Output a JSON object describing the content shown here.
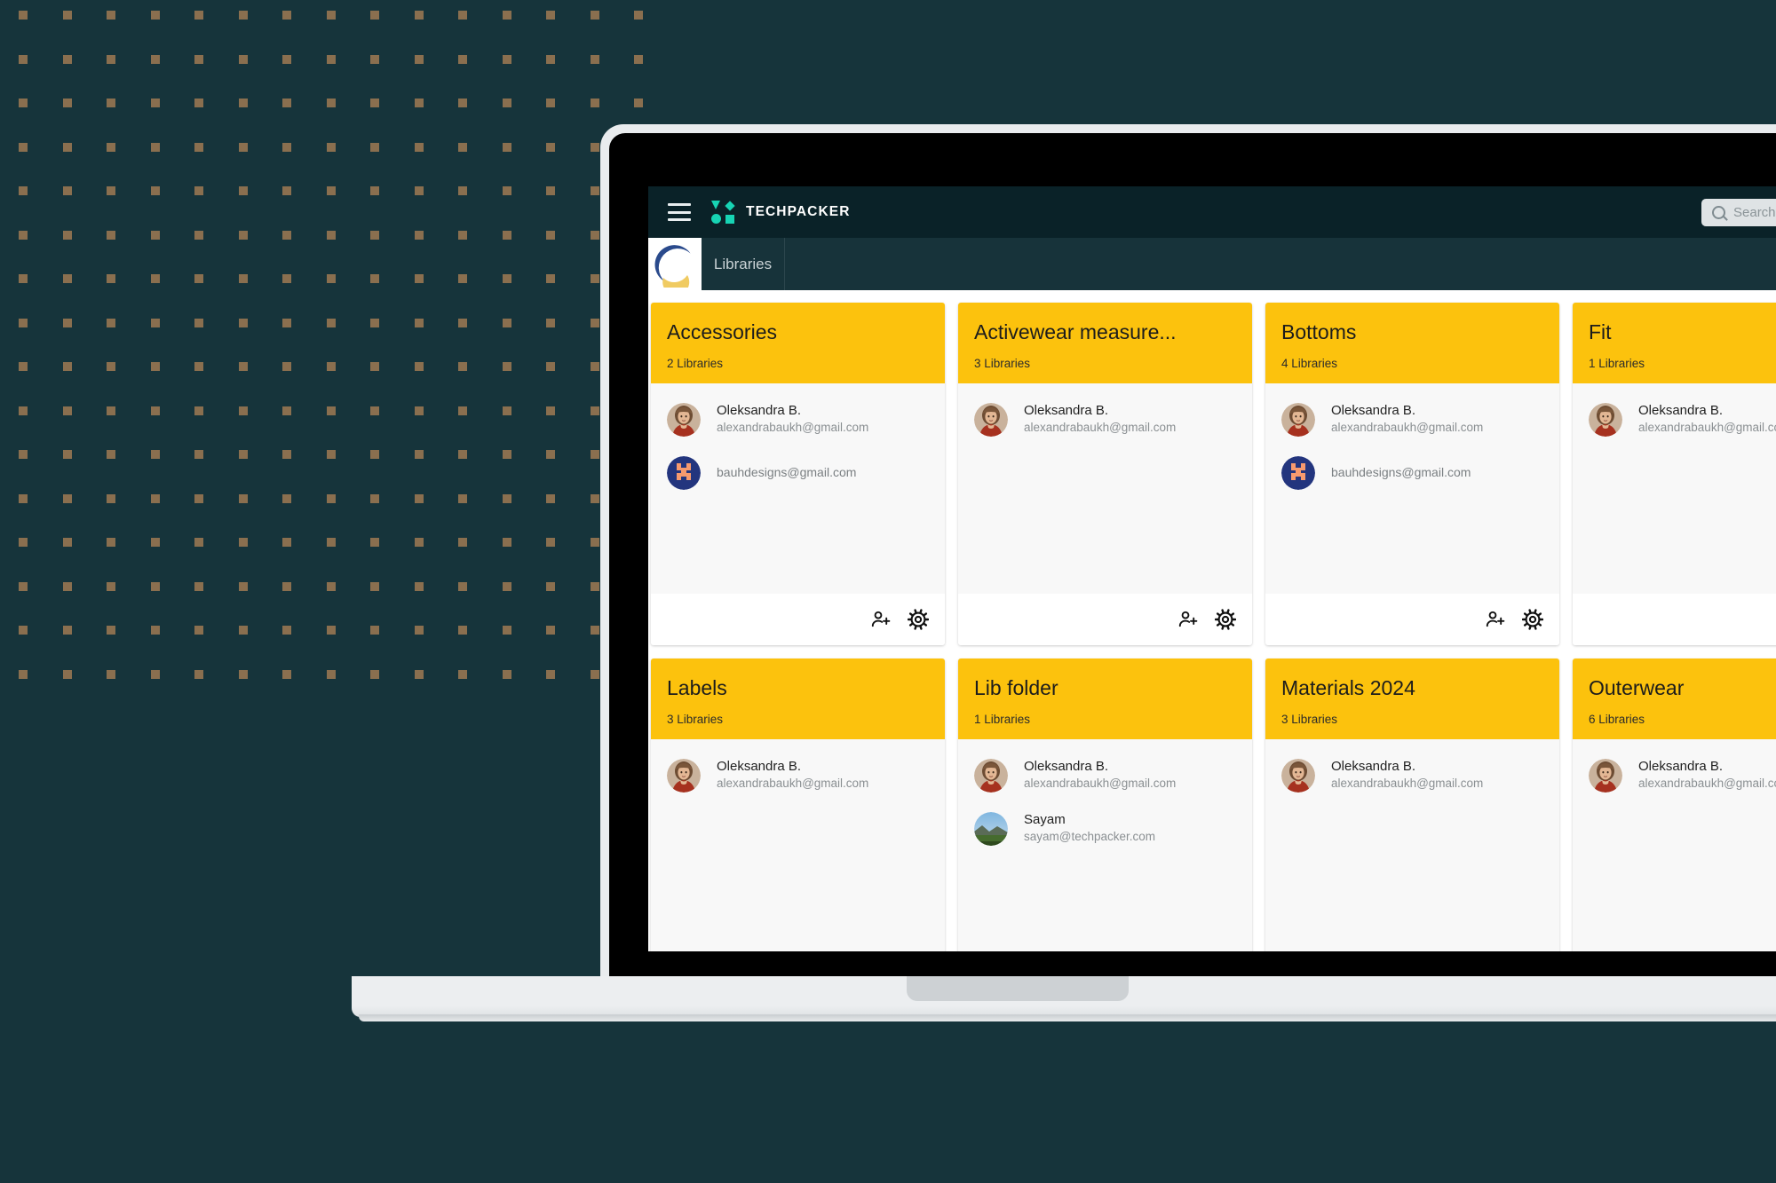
{
  "theme": {
    "backdrop": "#16343b",
    "dot_color": "#8a6f4f",
    "navbar_bg": "#0a2228",
    "tabbar_bg": "#17333a",
    "card_header_yellow": "#fcc20d",
    "brand_teal": "#17d4b4"
  },
  "topnav": {
    "menu_icon": "hamburger-icon",
    "logo_icon": "techpacker-logo-icon",
    "brand": "TECHPACKER",
    "search": {
      "icon": "search-icon",
      "placeholder": "Search Tec"
    }
  },
  "tabbar": {
    "workspace_logo_icon": "workspace-crescent-logo-icon",
    "tabs": [
      {
        "label": "Libraries"
      }
    ]
  },
  "footer_icons": {
    "add_member": "person-add-icon",
    "settings": "gear-icon"
  },
  "cards": [
    {
      "title": "Accessories",
      "count": "2 Libraries",
      "members": [
        {
          "avatar": "photo-woman-avatar",
          "name": "Oleksandra B.",
          "email": "alexandrabaukh@gmail.com"
        },
        {
          "avatar": "bauh-monogram-avatar",
          "name": "",
          "email": "bauhdesigns@gmail.com"
        }
      ],
      "has_footer": true
    },
    {
      "title": "Activewear measure...",
      "count": "3 Libraries",
      "members": [
        {
          "avatar": "photo-woman-avatar",
          "name": "Oleksandra B.",
          "email": "alexandrabaukh@gmail.com"
        }
      ],
      "has_footer": true
    },
    {
      "title": "Bottoms",
      "count": "4 Libraries",
      "members": [
        {
          "avatar": "photo-woman-avatar",
          "name": "Oleksandra B.",
          "email": "alexandrabaukh@gmail.com"
        },
        {
          "avatar": "bauh-monogram-avatar",
          "name": "",
          "email": "bauhdesigns@gmail.com"
        }
      ],
      "has_footer": true
    },
    {
      "title": "Fit",
      "count": "1 Libraries",
      "members": [
        {
          "avatar": "photo-woman-avatar",
          "name": "Oleksandra B.",
          "email": "alexandrabaukh@gmail.com"
        }
      ],
      "has_footer": true
    },
    {
      "title": "Labels",
      "count": "3 Libraries",
      "members": [
        {
          "avatar": "photo-woman-avatar",
          "name": "Oleksandra B.",
          "email": "alexandrabaukh@gmail.com"
        }
      ],
      "has_footer": false
    },
    {
      "title": "Lib folder",
      "count": "1 Libraries",
      "members": [
        {
          "avatar": "photo-woman-avatar",
          "name": "Oleksandra B.",
          "email": "alexandrabaukh@gmail.com"
        },
        {
          "avatar": "photo-landscape-avatar",
          "name": "Sayam",
          "email": "sayam@techpacker.com"
        }
      ],
      "has_footer": false
    },
    {
      "title": "Materials 2024",
      "count": "3 Libraries",
      "members": [
        {
          "avatar": "photo-woman-avatar",
          "name": "Oleksandra B.",
          "email": "alexandrabaukh@gmail.com"
        }
      ],
      "has_footer": false
    },
    {
      "title": "Outerwear",
      "count": "6 Libraries",
      "members": [
        {
          "avatar": "photo-woman-avatar",
          "name": "Oleksandra B.",
          "email": "alexandrabaukh@gmail.com"
        }
      ],
      "has_footer": false
    }
  ]
}
